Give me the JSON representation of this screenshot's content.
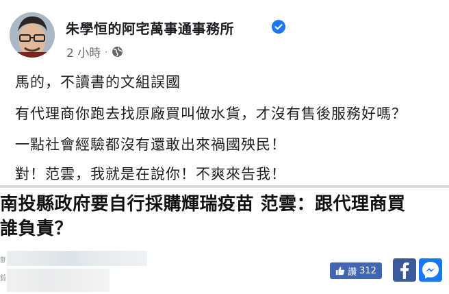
{
  "post": {
    "page_name": "朱學恒的阿宅萬事通事務所",
    "time": "2 小時",
    "dot": "·",
    "lines": [
      "馬的，不讀書的文組誤國",
      "有代理商你跑去找原廠買叫做水貨，才沒有售後服務好嗎？",
      "一點社會經驗都沒有還敢出來禍國殃民！",
      "對！范雲，我就是在說你！不爽來告我！"
    ]
  },
  "headline": {
    "line1": "南投縣政府要自行採購輝瑞疫苗 范雲：跟代理商買",
    "line2": "誰負責？"
  },
  "share": {
    "like_label": "讚",
    "like_count": "312"
  },
  "edge": {
    "char1": "新",
    "char2": "錄"
  },
  "colors": {
    "facebook_blue": "#4267b2",
    "verified_blue": "#1877f2"
  }
}
